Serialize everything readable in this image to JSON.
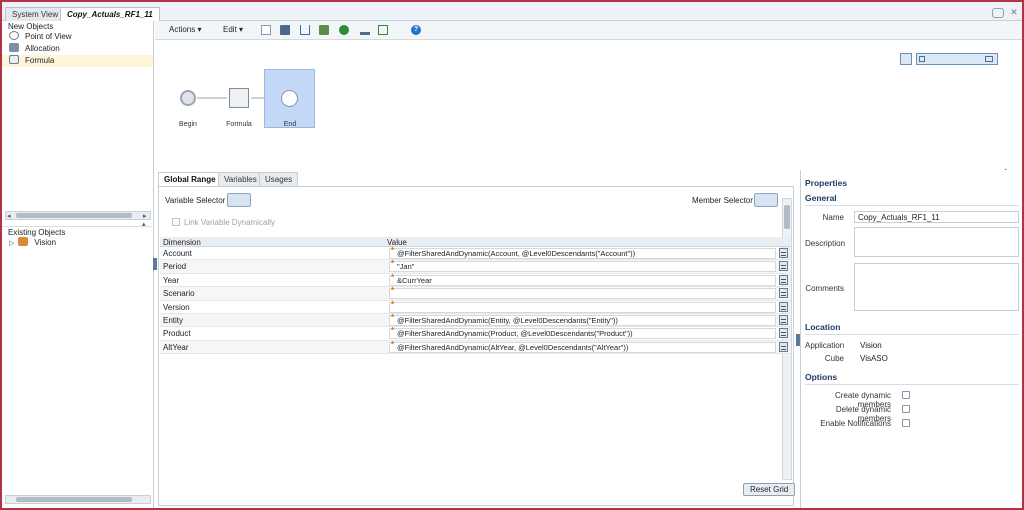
{
  "tabs": {
    "system_view": "System View",
    "active_rule": "Copy_Actuals_RF1_11"
  },
  "left_panel": {
    "new_objects_title": "New Objects",
    "new_objects": [
      "Point of View",
      "Allocation",
      "Formula"
    ],
    "existing_objects_title": "Existing Objects",
    "existing_objects": [
      "Vision"
    ]
  },
  "toolbar": {
    "actions": "Actions",
    "edit": "Edit"
  },
  "canvas": {
    "nodes": [
      "Begin",
      "Formula",
      "End"
    ]
  },
  "designer": {
    "tabs": [
      "Global Range",
      "Variables",
      "Usages"
    ],
    "variable_selector": "Variable Selector",
    "member_selector": "Member Selector",
    "link_variable": "Link Variable Dynamically",
    "grid_headers": [
      "Dimension",
      "Value"
    ],
    "grid_rows": [
      {
        "dimension": "Account",
        "value": "@FilterSharedAndDynamic(Account, @Level0Descendants(\"Account\"))"
      },
      {
        "dimension": "Period",
        "value": "\"Jan\""
      },
      {
        "dimension": "Year",
        "value": "&CurrYear"
      },
      {
        "dimension": "Scenario",
        "value": ""
      },
      {
        "dimension": "Version",
        "value": ""
      },
      {
        "dimension": "Entity",
        "value": "@FilterSharedAndDynamic(Entity, @Level0Descendants(\"Entity\"))"
      },
      {
        "dimension": "Product",
        "value": "@FilterSharedAndDynamic(Product, @Level0Descendants(\"Product\"))"
      },
      {
        "dimension": "AltYear",
        "value": "@FilterSharedAndDynamic(AltYear, @Level0Descendants(\"AltYear\"))"
      }
    ],
    "reset_grid": "Reset Grid"
  },
  "properties": {
    "title": "Properties",
    "general_title": "General",
    "name_label": "Name",
    "name_value": "Copy_Actuals_RF1_11",
    "description_label": "Description",
    "comments_label": "Comments",
    "location_title": "Location",
    "application_label": "Application",
    "application_value": "Vision",
    "cube_label": "Cube",
    "cube_value": "VisASO",
    "options_title": "Options",
    "options": [
      "Create dynamic members",
      "Delete dynamic members",
      "Enable Notifications"
    ]
  },
  "colors": {
    "frame_border": "#b2324a",
    "accent_blue": "#1c3c66",
    "end_node": "#c4d9f7",
    "value_marker": "#e06c00"
  }
}
